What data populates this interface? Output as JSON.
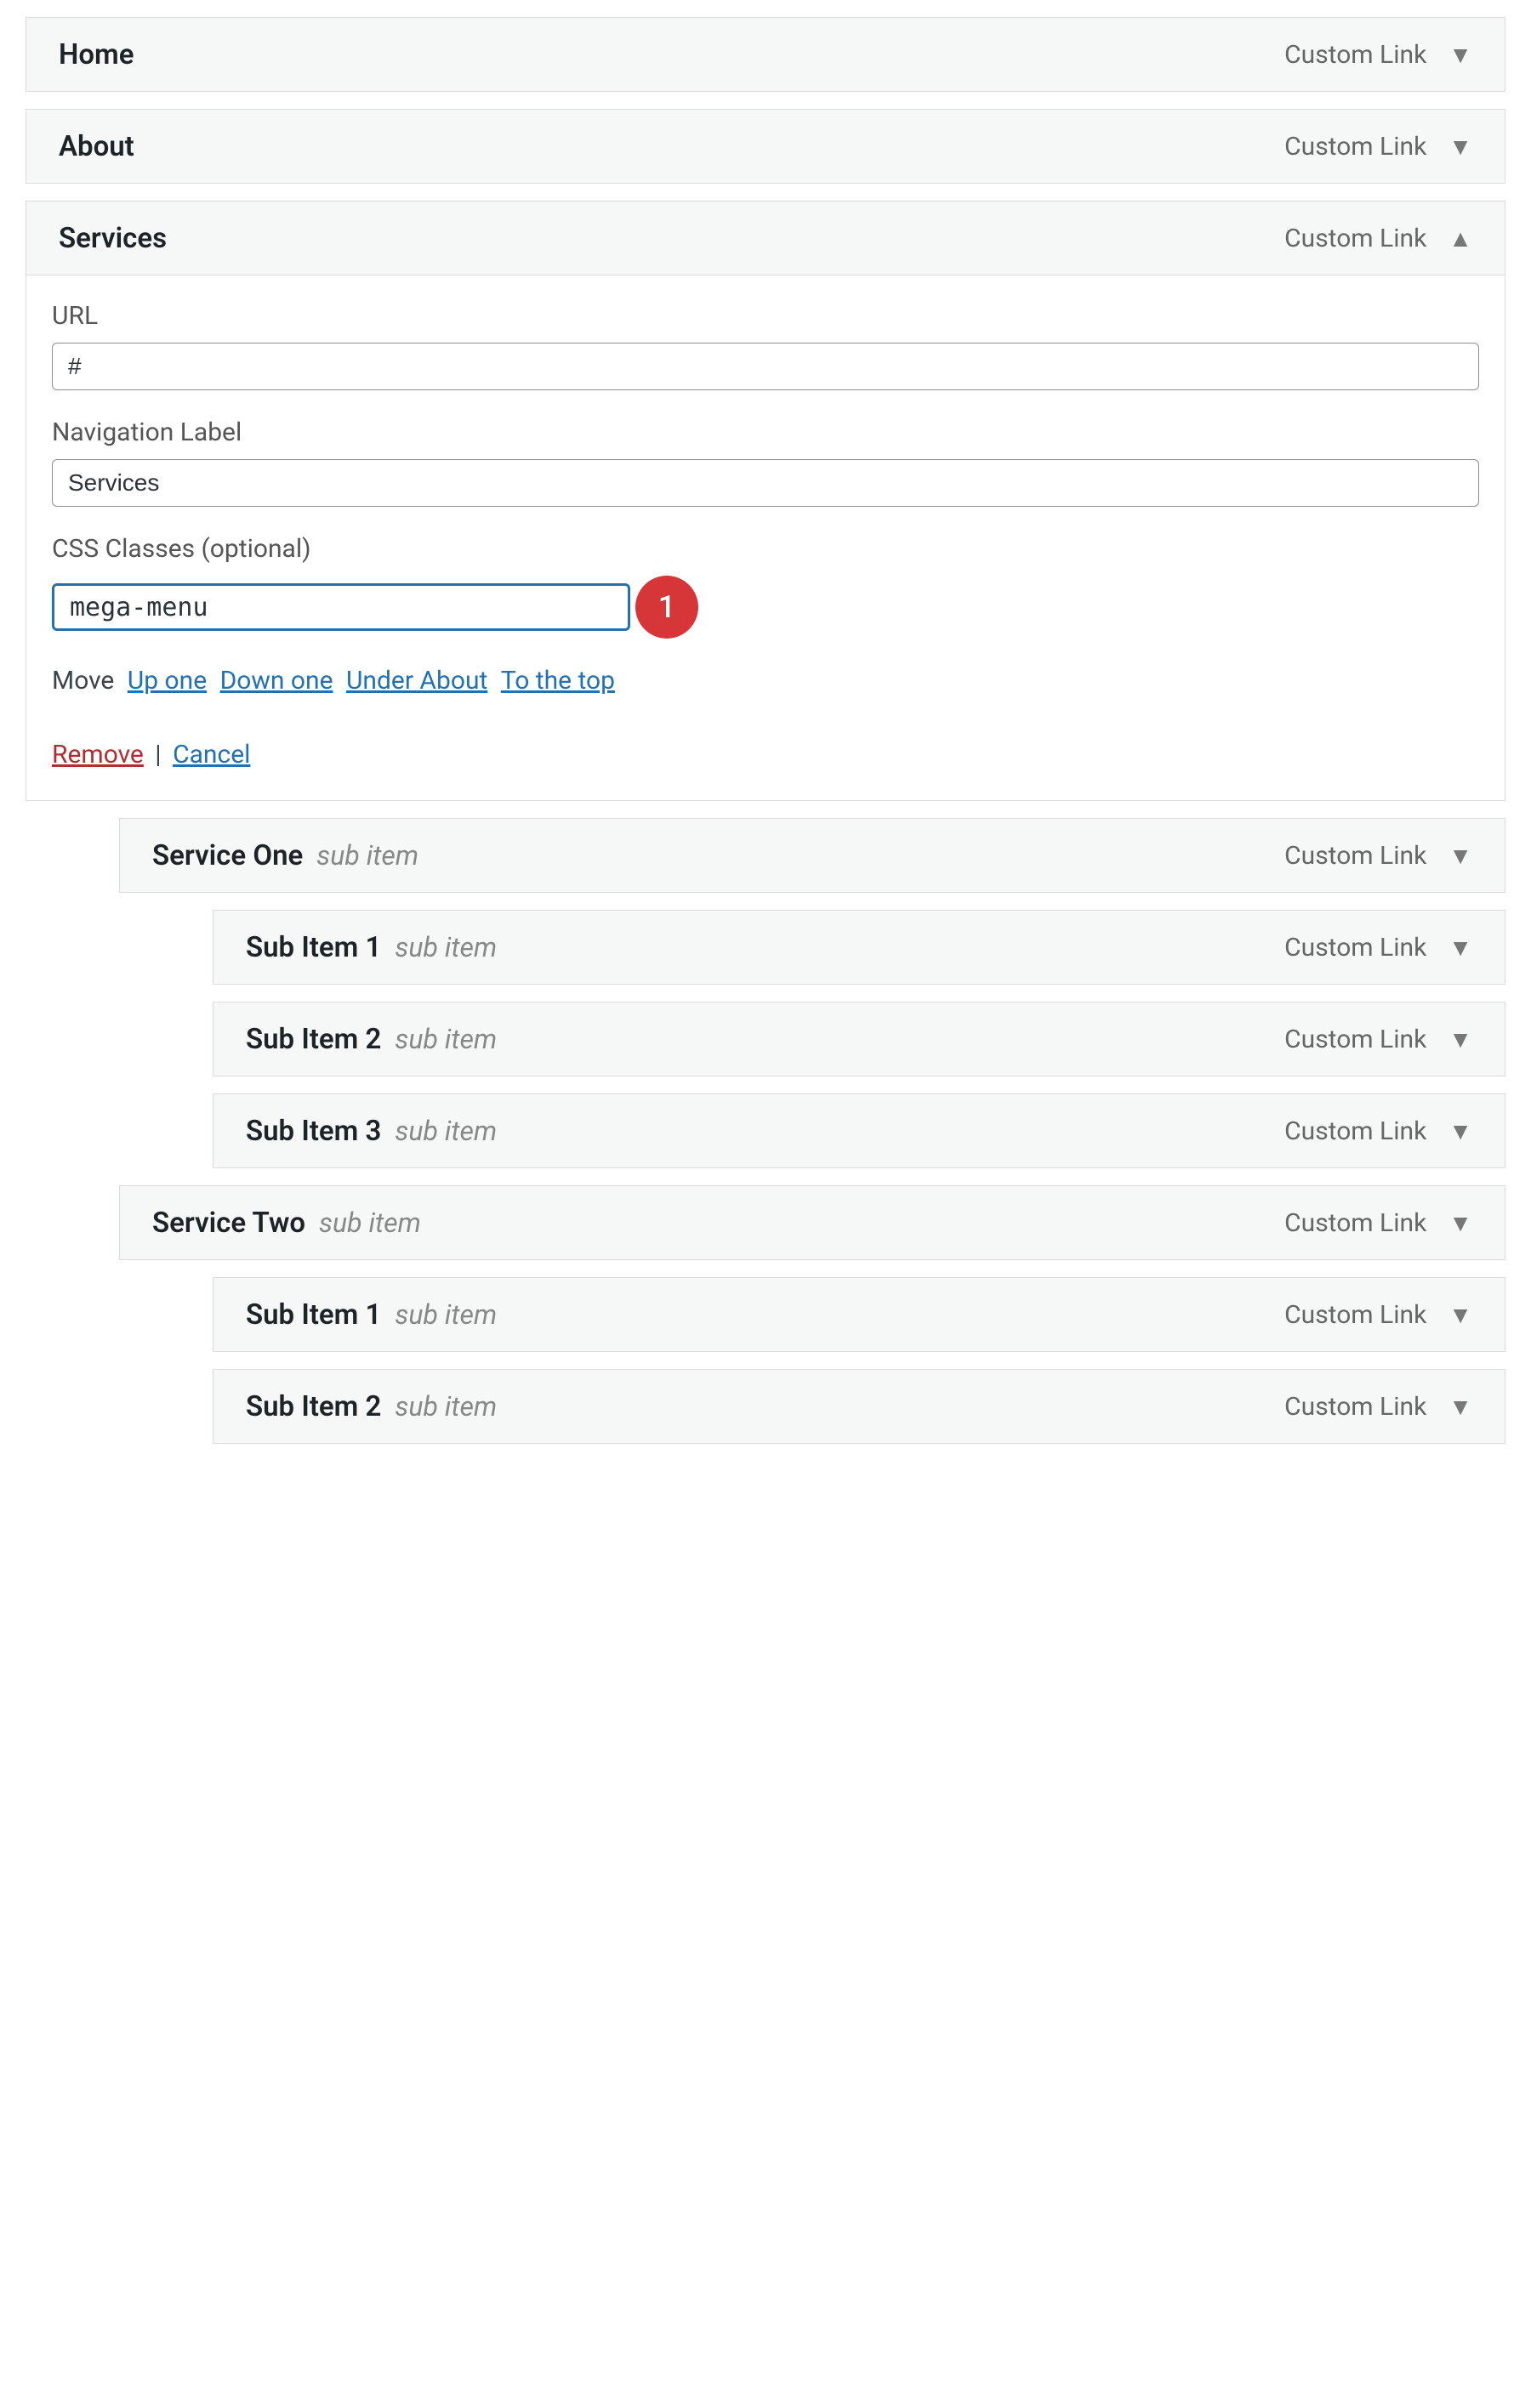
{
  "item_type_label": "Custom Link",
  "sub_item_label": "sub item",
  "annotation": {
    "number": "1"
  },
  "items": [
    {
      "title": "Home",
      "indent": 0
    },
    {
      "title": "About",
      "indent": 0
    },
    {
      "title": "Services",
      "indent": 0,
      "open": true,
      "fields": {
        "url_label": "URL",
        "url_value": "#",
        "nav_label": "Navigation Label",
        "nav_value": "Services",
        "css_label": "CSS Classes (optional)",
        "css_value": "mega-menu"
      },
      "move": {
        "label": "Move",
        "up": "Up one",
        "down": "Down one",
        "under": "Under About",
        "top": "To the top"
      },
      "actions": {
        "remove": "Remove",
        "cancel": "Cancel"
      }
    },
    {
      "title": "Service One",
      "indent": 1
    },
    {
      "title": "Sub Item 1",
      "indent": 2
    },
    {
      "title": "Sub Item 2",
      "indent": 2
    },
    {
      "title": "Sub Item 3",
      "indent": 2
    },
    {
      "title": "Service Two",
      "indent": 1
    },
    {
      "title": "Sub Item 1",
      "indent": 2
    },
    {
      "title": "Sub Item 2",
      "indent": 2
    }
  ]
}
